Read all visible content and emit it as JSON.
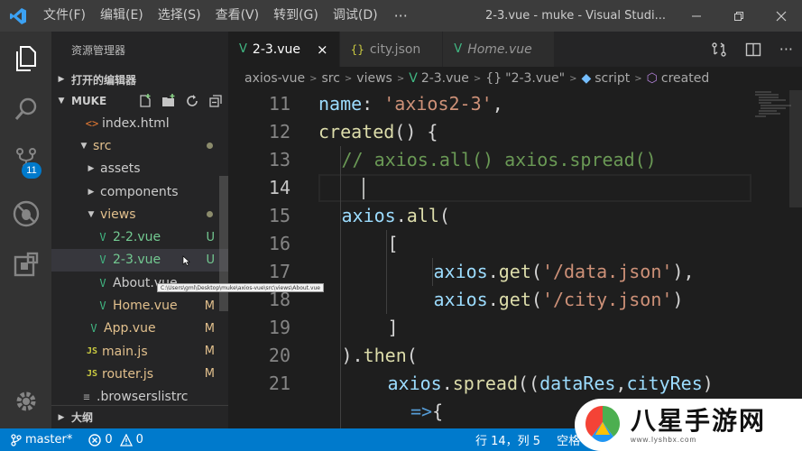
{
  "titlebar": {
    "menu": [
      "文件(F)",
      "编辑(E)",
      "选择(S)",
      "查看(V)",
      "转到(G)",
      "调试(D)"
    ],
    "more": "···",
    "window_title": "2-3.vue - muke - Visual Studi..."
  },
  "activity": {
    "badge": "11"
  },
  "sidebar": {
    "title": "资源管理器",
    "open_editors": "打开的编辑器",
    "folder": "MUKE",
    "outline": "大纲",
    "tree": [
      {
        "label": "index.html",
        "icon": "<>",
        "status": ""
      },
      {
        "label": "src",
        "status": "dot"
      },
      {
        "label": "assets",
        "status": ""
      },
      {
        "label": "components",
        "status": ""
      },
      {
        "label": "views",
        "status": "dot"
      },
      {
        "label": "2-2.vue",
        "status": "U"
      },
      {
        "label": "2-3.vue",
        "status": "U"
      },
      {
        "label": "About.vue",
        "status": ""
      },
      {
        "label": "Home.vue",
        "status": "M"
      },
      {
        "label": "App.vue",
        "status": "M"
      },
      {
        "label": "main.js",
        "icon": "JS",
        "status": "M"
      },
      {
        "label": "router.js",
        "icon": "JS",
        "status": "M"
      },
      {
        "label": ".browserslistrc",
        "icon": "≡",
        "status": ""
      }
    ],
    "tooltip": "C:\\Users\\gml\\Desktop\\muke\\axios-vue\\src\\views\\About.vue"
  },
  "tabs": [
    {
      "label": "2-3.vue",
      "close": "×"
    },
    {
      "label": "city.json",
      "icon": "{}"
    },
    {
      "label": "Home.vue"
    }
  ],
  "breadcrumb": {
    "items": [
      "axios-vue",
      "src",
      "views",
      "2-3.vue",
      "\"2-3.vue\"",
      "script",
      "created"
    ],
    "obj_icon": "{}"
  },
  "editor": {
    "line_numbers": [
      "11",
      "12",
      "13",
      "14",
      "15",
      "16",
      "17",
      "18",
      "19",
      "20",
      "21",
      ""
    ],
    "lines": [
      {
        "t1": "name",
        "t2": ": ",
        "t3": "'axios2-3'",
        "t4": ","
      },
      {
        "t1": "created",
        "t2": "() {"
      },
      {
        "t1": "// axios.all() axios.spread()"
      },
      {
        "t1": ""
      },
      {
        "t1": "axios",
        "t2": ".",
        "t3": "all",
        "t4": "("
      },
      {
        "t1": "["
      },
      {
        "t1": "axios",
        "t2": ".",
        "t3": "get",
        "t4": "(",
        "t5": "'/data.json'",
        "t6": "),"
      },
      {
        "t1": "axios",
        "t2": ".",
        "t3": "get",
        "t4": "(",
        "t5": "'/city.json'",
        "t6": ")"
      },
      {
        "t1": "]"
      },
      {
        "t1": ").",
        "t2": "then",
        "t3": "("
      },
      {
        "t1": "axios",
        "t2": ".",
        "t3": "spread",
        "t4": "((",
        "t5": "dataRes",
        "t6": ",",
        "t7": "cityRes",
        "t8": ")"
      },
      {
        "t1": "=>",
        "t2": "{"
      }
    ]
  },
  "statusbar": {
    "branch": "master*",
    "errors": "0",
    "warnings": "0",
    "cursor": "行 14，列 5",
    "spaces": "空格"
  },
  "watermark": {
    "name": "八星手游网",
    "url": "www.lyshbx.com"
  },
  "colors": {
    "accent": "#007acc",
    "vue_green": "#41b883",
    "untracked": "#73c991",
    "modified": "#e2c08d"
  }
}
